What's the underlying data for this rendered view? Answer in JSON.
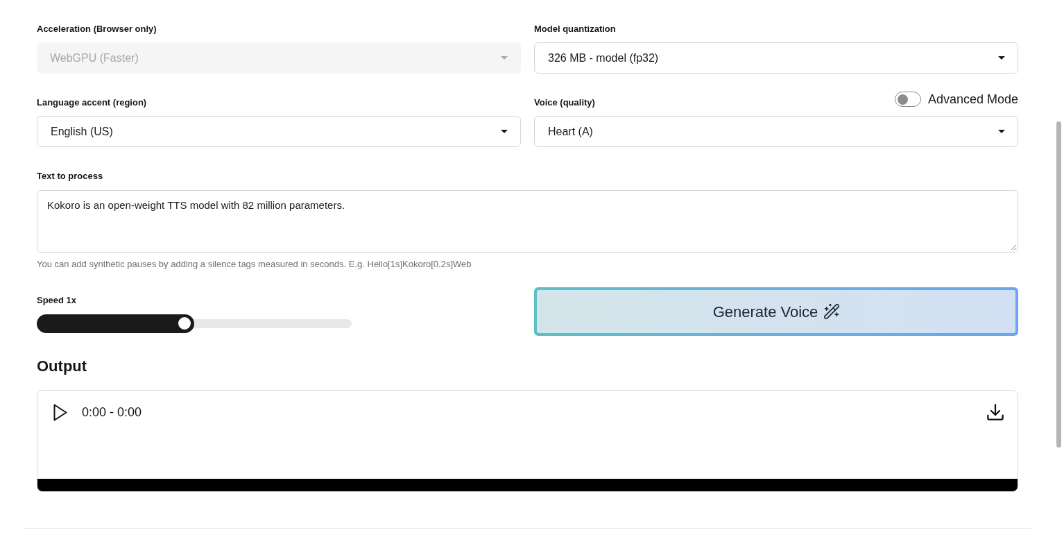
{
  "selects": [
    {
      "label": "Acceleration (Browser only)",
      "value": "WebGPU (Faster)",
      "disabled": true
    },
    {
      "label": "Model quantization",
      "value": "326 MB - model (fp32)",
      "disabled": false
    },
    {
      "label": "Language accent (region)",
      "value": "English (US)",
      "disabled": false
    },
    {
      "label": "Voice (quality)",
      "value": "Heart (A)",
      "disabled": false,
      "toggle": {
        "label": "Advanced Mode",
        "on": false
      }
    }
  ],
  "text_input": {
    "label": "Text to process",
    "value": "Kokoro is an open-weight TTS model with 82 million parameters.",
    "hint": "You can add synthetic pauses by adding a silence tags measured in seconds. E.g. Hello[1s]Kokoro[0.2s]Web"
  },
  "speed": {
    "label": "Speed 1x",
    "level": 0.5
  },
  "generate_button": {
    "label": "Generate Voice"
  },
  "output": {
    "title": "Output",
    "player": {
      "time": "0:00 - 0:00"
    }
  }
}
